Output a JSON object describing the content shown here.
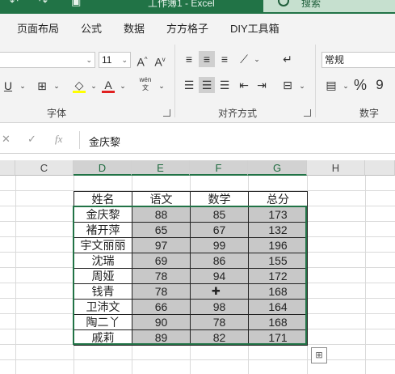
{
  "window": {
    "title": "工作簿1 - Excel",
    "search_placeholder": "搜索"
  },
  "tabs": [
    "页面布局",
    "公式",
    "数据",
    "方方格子",
    "DIY工具箱"
  ],
  "ribbon": {
    "font_size": "11",
    "number_format": "Normal_zh",
    "number_format_label": "常规",
    "groups": {
      "font": "字体",
      "alignment": "对齐方式",
      "number": "数字"
    },
    "wen_label": "wén\n文",
    "percent": "%",
    "comma": "9"
  },
  "formula_bar": {
    "fx": "fx",
    "value": "金庆黎"
  },
  "columns": [
    "C",
    "D",
    "E",
    "F",
    "G",
    "H"
  ],
  "table": {
    "headers": [
      "姓名",
      "语文",
      "数学",
      "总分"
    ],
    "rows": [
      [
        "金庆黎",
        "88",
        "85",
        "173"
      ],
      [
        "褚开萍",
        "65",
        "67",
        "132"
      ],
      [
        "宇文丽丽",
        "97",
        "99",
        "196"
      ],
      [
        "沈瑞",
        "69",
        "86",
        "155"
      ],
      [
        "周娅",
        "78",
        "94",
        "172"
      ],
      [
        "钱青",
        "78",
        "",
        "168"
      ],
      [
        "卫沛文",
        "66",
        "98",
        "164"
      ],
      [
        "陶二丫",
        "90",
        "78",
        "168"
      ],
      [
        "戚莉",
        "89",
        "82",
        "171"
      ]
    ]
  }
}
